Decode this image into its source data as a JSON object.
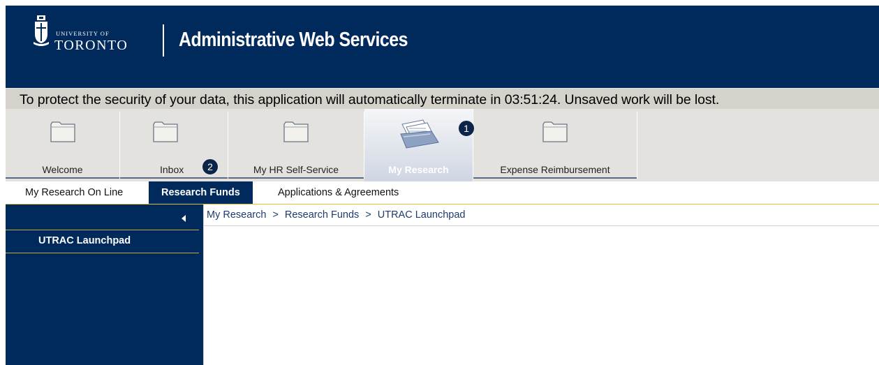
{
  "header": {
    "logo_top": "UNIVERSITY OF",
    "logo_bottom": "TORONTO",
    "title": "Administrative Web Services"
  },
  "banner": {
    "text": "To protect the security of your data, this application will automatically terminate in 03:51:24. Unsaved work will be lost."
  },
  "tabs": [
    {
      "label": "Welcome",
      "icon": "folder-icon"
    },
    {
      "label": "Inbox",
      "icon": "folder-icon"
    },
    {
      "label": "My HR Self-Service",
      "icon": "folder-icon"
    },
    {
      "label": "My Research",
      "icon": "research-documents-icon",
      "active": true
    },
    {
      "label": "Expense Reimbursement",
      "icon": "folder-icon"
    }
  ],
  "badges": [
    "1",
    "2"
  ],
  "subnav": [
    {
      "label": "My Research On Line"
    },
    {
      "label": "Research Funds",
      "active": true
    },
    {
      "label": "Applications & Agreements"
    }
  ],
  "leftnav": {
    "items": [
      "UTRAC Launchpad"
    ]
  },
  "breadcrumb": [
    "My Research",
    "Research Funds",
    "UTRAC Launchpad"
  ],
  "colors": {
    "navy": "#002a5c",
    "gold": "#e6b93f",
    "banner": "#d4d2cb",
    "tabbar": "#e3e2df"
  }
}
